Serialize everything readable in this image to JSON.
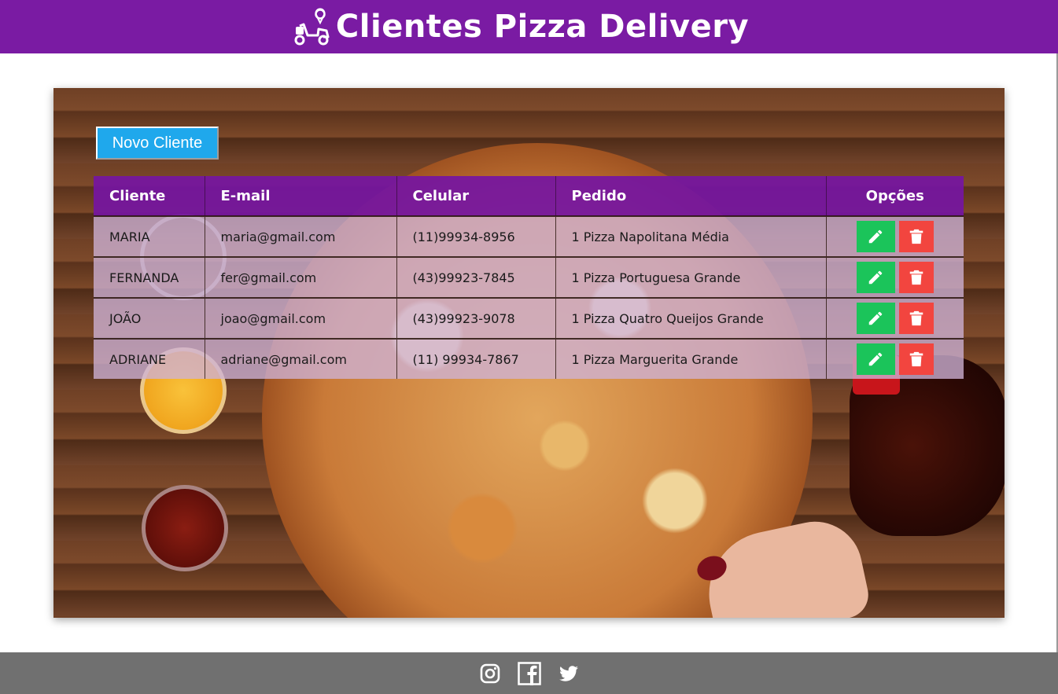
{
  "header": {
    "title": "Clientes Pizza Delivery",
    "logo_icon": "scooter-delivery-icon",
    "background": "#7a1ba3"
  },
  "toolbar": {
    "new_client_label": "Novo Cliente"
  },
  "table": {
    "columns": [
      "Cliente",
      "E-mail",
      "Celular",
      "Pedido",
      "Opções"
    ],
    "rows": [
      {
        "cliente": "MARIA",
        "email": "maria@gmail.com",
        "celular": "(11)99934-8956",
        "pedido": "1 Pizza Napolitana Média"
      },
      {
        "cliente": "FERNANDA",
        "email": "fer@gmail.com",
        "celular": "(43)99923-7845",
        "pedido": "1 Pizza Portuguesa Grande"
      },
      {
        "cliente": "JOÃO",
        "email": "joao@gmail.com",
        "celular": "(43)99923-9078",
        "pedido": "1 Pizza Quatro Queijos Grande"
      },
      {
        "cliente": "ADRIANE",
        "email": "adriane@gmail.com",
        "celular": "(11) 99934-7867",
        "pedido": "1 Pizza Marguerita Grande"
      }
    ],
    "row_actions": {
      "edit_icon": "pencil-icon",
      "delete_icon": "trash-icon"
    }
  },
  "colors": {
    "header_purple": "#7a1ba3",
    "new_button_blue": "#1fa8ec",
    "edit_green": "#1bc45a",
    "delete_red": "#f2453f",
    "footer_gray": "#707070"
  },
  "footer": {
    "social": [
      {
        "name": "instagram-icon"
      },
      {
        "name": "facebook-icon"
      },
      {
        "name": "twitter-icon"
      }
    ]
  }
}
